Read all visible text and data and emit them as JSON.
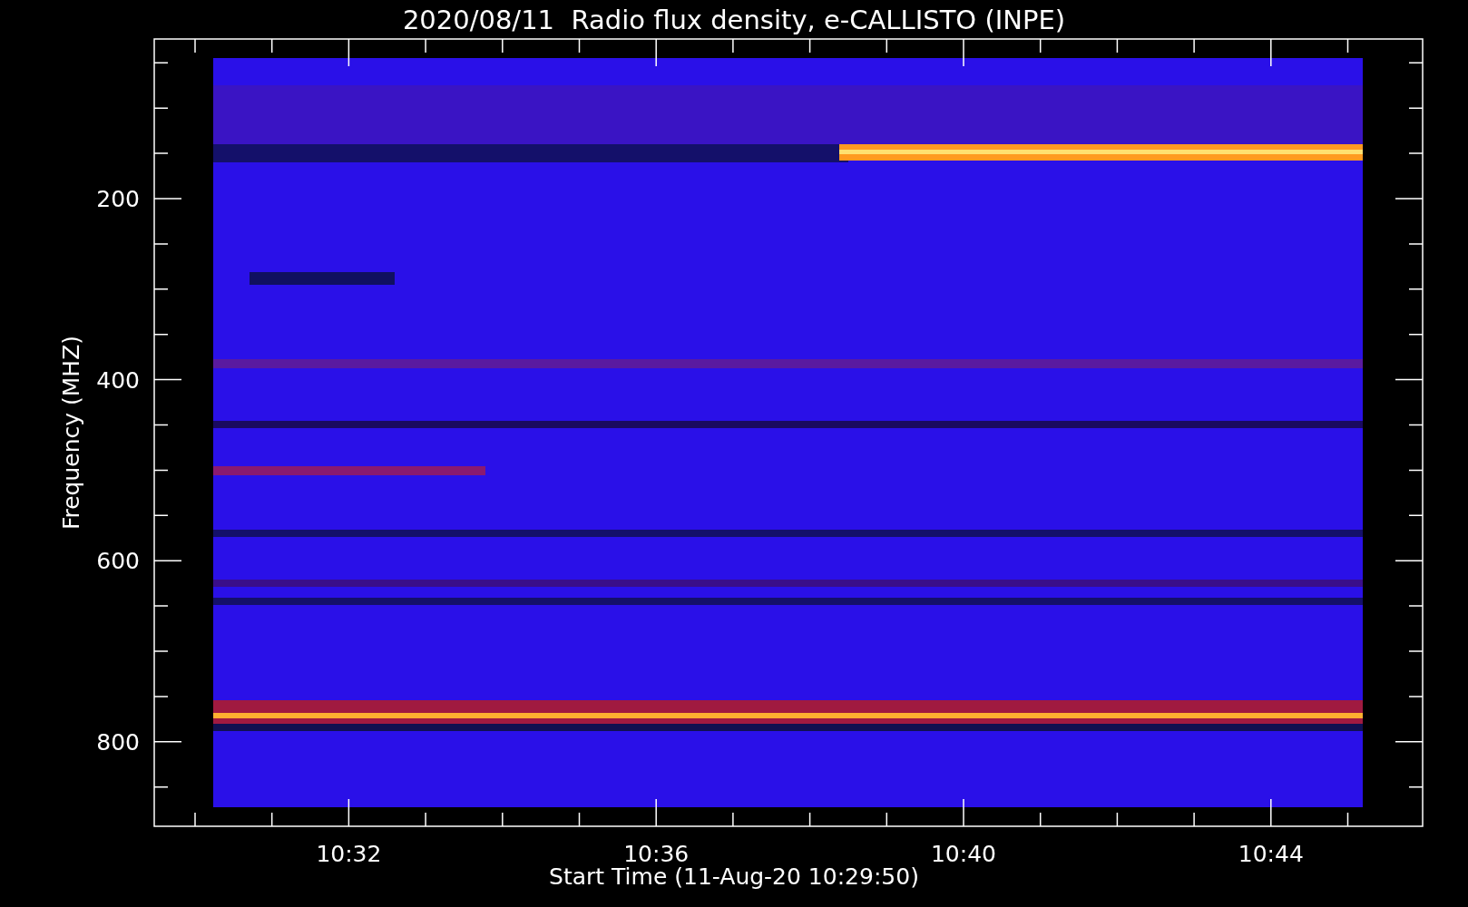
{
  "title": "2020/08/11  Radio flux density, e-CALLISTO (INPE)",
  "y_axis": {
    "label": "Frequency (MHZ)",
    "ticks": [
      "200",
      "400",
      "600",
      "800"
    ]
  },
  "x_axis": {
    "label": "Start Time (11-Aug-20 10:29:50)",
    "ticks": [
      "10:32",
      "10:36",
      "10:40",
      "10:44"
    ]
  }
}
